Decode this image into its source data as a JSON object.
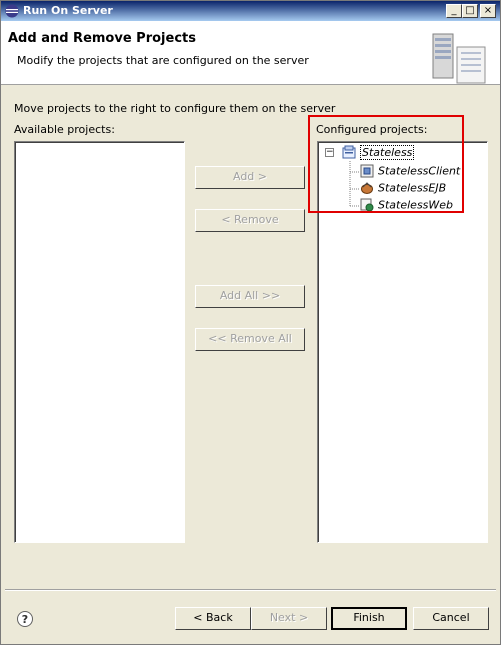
{
  "window": {
    "title": "Run On Server",
    "btn_min": "_",
    "btn_max": "□",
    "btn_close": "×"
  },
  "header": {
    "title": "Add and Remove Projects",
    "description": "Modify the projects that are configured on the server"
  },
  "main": {
    "instruction": "Move projects to the right to configure them on the server",
    "available_label": "Available projects:",
    "configured_label": "Configured projects:"
  },
  "buttons": {
    "add": "Add >",
    "remove": "< Remove",
    "add_all": "Add All >>",
    "remove_all": "<< Remove All"
  },
  "tree": {
    "root": {
      "label": "Stateless",
      "expander": "−"
    },
    "children": [
      {
        "label": "StatelessClient",
        "icon": "app-client-icon"
      },
      {
        "label": "StatelessEJB",
        "icon": "ejb-bean-icon"
      },
      {
        "label": "StatelessWeb",
        "icon": "web-module-icon"
      }
    ]
  },
  "footer": {
    "help": "?",
    "back": "< Back",
    "next": "Next >",
    "finish": "Finish",
    "cancel": "Cancel"
  },
  "colors": {
    "highlight_box": "#e00000",
    "title_bar": "#0a246a"
  }
}
